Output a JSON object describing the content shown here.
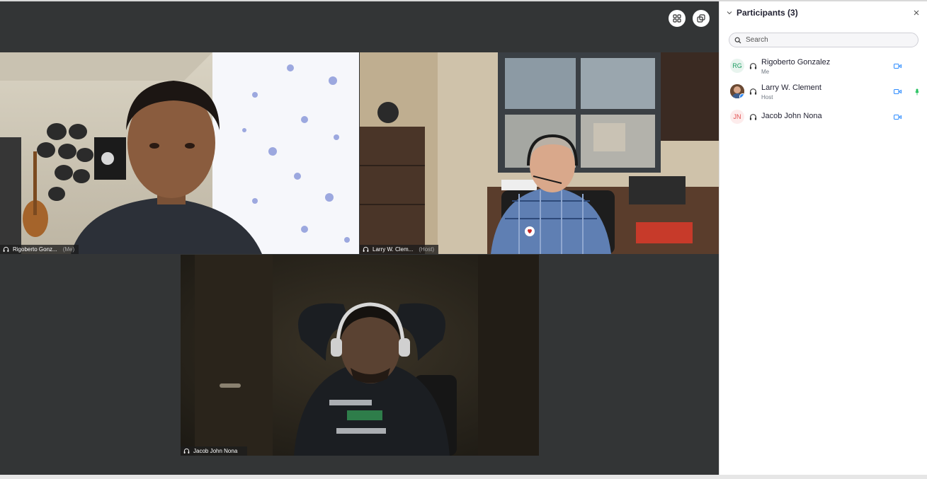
{
  "stage": {
    "grid_view_icon": "grid-view-icon",
    "popout_icon": "popout-icon",
    "tiles": [
      {
        "name": "Rigoberto Gonz...",
        "role": "(Me)",
        "audio_icon": "audio-headphone-icon"
      },
      {
        "name": "Larry W. Clem...",
        "role": "(Host)",
        "audio_icon": "audio-headphone-icon"
      },
      {
        "name": "Jacob John Nona",
        "role": "",
        "audio_icon": "audio-headphone-icon"
      }
    ]
  },
  "participants_panel": {
    "title": "Participants (3)",
    "collapse_icon": "chevron-down-icon",
    "close_icon": "close-icon",
    "search": {
      "placeholder": "Search",
      "value": "",
      "icon": "search-icon"
    },
    "list": [
      {
        "initials": "RG",
        "name": "Rigoberto Gonzalez",
        "role": "Me",
        "video_icon": "video-camera-icon",
        "mic": ""
      },
      {
        "initials": "",
        "name": "Larry W. Clement",
        "role": "Host",
        "video_icon": "video-camera-icon",
        "mic": "mic-active-icon"
      },
      {
        "initials": "JN",
        "name": "Jacob John Nona",
        "role": "",
        "video_icon": "video-camera-icon",
        "mic": ""
      }
    ]
  },
  "colors": {
    "stage_bg": "#333536",
    "accent_blue": "#2d8cff",
    "rg_avatar": "#1e9c63",
    "jn_avatar": "#e25050",
    "mic_green": "#23c25d"
  }
}
